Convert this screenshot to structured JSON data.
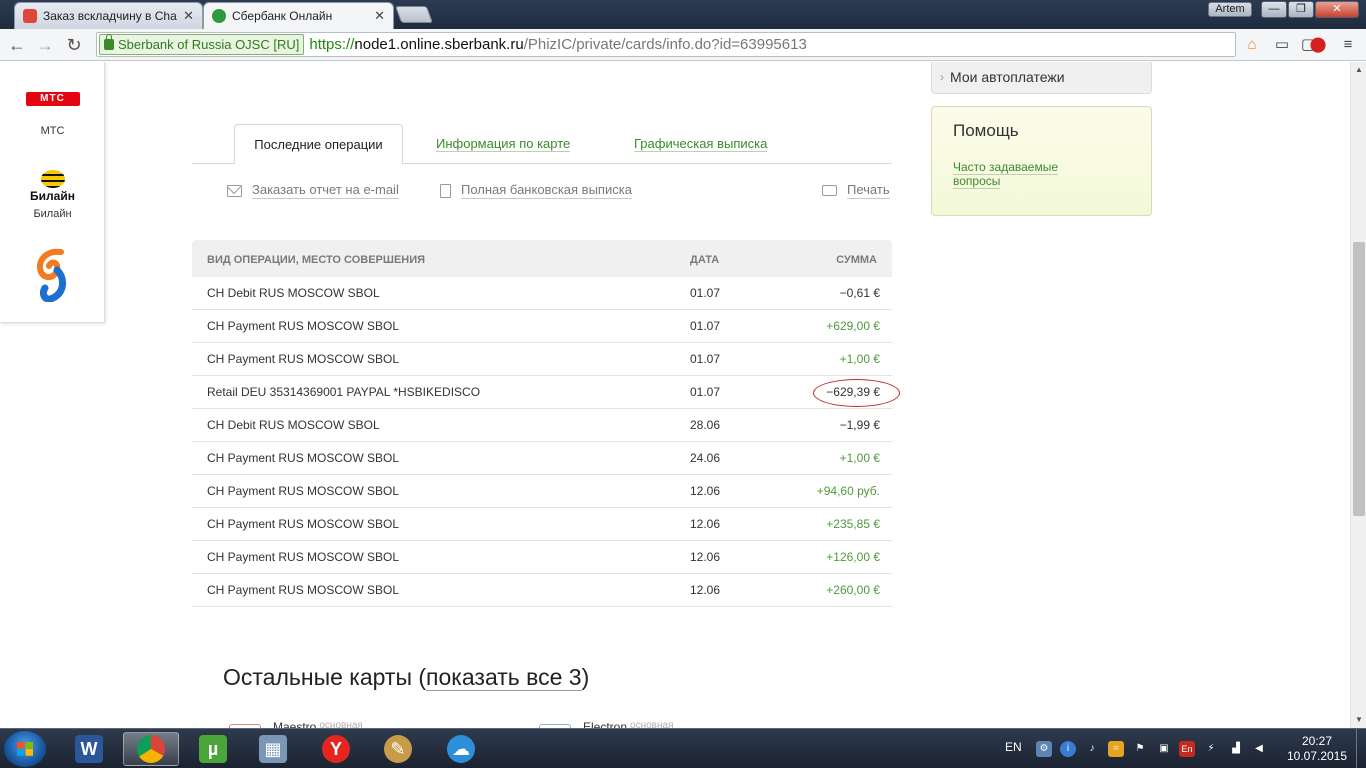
{
  "browser": {
    "tabs": [
      {
        "title": "Заказ вскладчину в Chai",
        "active": false
      },
      {
        "title": "Сбербанк Онлайн",
        "active": true
      }
    ],
    "user": "Artem",
    "window_buttons": {
      "minimize": "—",
      "maximize": "❐",
      "close": "✕"
    },
    "nav": {
      "back": "←",
      "forward": "→",
      "reload": "↻"
    },
    "ev_cert": "Sberbank of Russia OJSC [RU]",
    "url": {
      "scheme": "https://",
      "host": "node1.online.sberbank.ru",
      "path": "/PhizIC/private/cards/info.do?id=63995613"
    }
  },
  "left_panel": {
    "providers": [
      {
        "name": "МТС",
        "logo_text": "МТС"
      },
      {
        "name": "Билайн",
        "logo_text": "Билайн"
      },
      {
        "name": "",
        "logo_text": ""
      }
    ]
  },
  "card_tabs": [
    {
      "label": "Последние операции",
      "active": true
    },
    {
      "label": "Информация по карте",
      "active": false
    },
    {
      "label": "Графическая выписка",
      "active": false
    }
  ],
  "actions": {
    "email_report": "Заказать отчет на e-mail",
    "full_statement": "Полная банковская выписка",
    "print": "Печать"
  },
  "operations": {
    "headers": {
      "name": "ВИД ОПЕРАЦИИ, МЕСТО СОВЕРШЕНИЯ",
      "date": "ДАТА",
      "amount": "СУММА"
    },
    "rows": [
      {
        "name": "CH Debit RUS MOSCOW SBOL",
        "date": "01.07",
        "amount": "−0,61 €",
        "sign": "neg"
      },
      {
        "name": "CH Payment RUS MOSCOW SBOL",
        "date": "01.07",
        "amount": "+629,00 €",
        "sign": "pos"
      },
      {
        "name": "CH Payment RUS MOSCOW SBOL",
        "date": "01.07",
        "amount": "+1,00 €",
        "sign": "pos"
      },
      {
        "name": "Retail DEU 35314369001 PAYPAL *HSBIKEDISCO",
        "date": "01.07",
        "amount": "−629,39 €",
        "sign": "neg",
        "highlight": true
      },
      {
        "name": "CH Debit RUS MOSCOW SBOL",
        "date": "28.06",
        "amount": "−1,99 €",
        "sign": "neg"
      },
      {
        "name": "CH Payment RUS MOSCOW SBOL",
        "date": "24.06",
        "amount": "+1,00 €",
        "sign": "pos"
      },
      {
        "name": "CH Payment RUS MOSCOW SBOL",
        "date": "12.06",
        "amount": "+94,60 руб.",
        "sign": "pos"
      },
      {
        "name": "CH Payment RUS MOSCOW SBOL",
        "date": "12.06",
        "amount": "+235,85 €",
        "sign": "pos"
      },
      {
        "name": "CH Payment RUS MOSCOW SBOL",
        "date": "12.06",
        "amount": "+126,00 €",
        "sign": "pos"
      },
      {
        "name": "CH Payment RUS MOSCOW SBOL",
        "date": "12.06",
        "amount": "+260,00 €",
        "sign": "pos"
      }
    ]
  },
  "other_cards": {
    "title_prefix": "Остальные карты (",
    "show_all_link": "показать все 3",
    "title_suffix": ")",
    "cards": [
      {
        "name": "Maestro",
        "tag": "основная"
      },
      {
        "name": "Electron",
        "tag": "основная"
      }
    ]
  },
  "right_column": {
    "autopay": "Мои автоплатежи",
    "help_title": "Помощь",
    "help_link": "Часто задаваемые вопросы"
  },
  "taskbar": {
    "lang": "EN",
    "tray_lang": "En",
    "time": "20:27",
    "date": "10.07.2015"
  },
  "colors": {
    "sber_green": "#3b8a2e",
    "positive_amount": "#4f9a3a",
    "highlight_circle": "#c1272d",
    "help_bg": "#f4f8d8"
  }
}
